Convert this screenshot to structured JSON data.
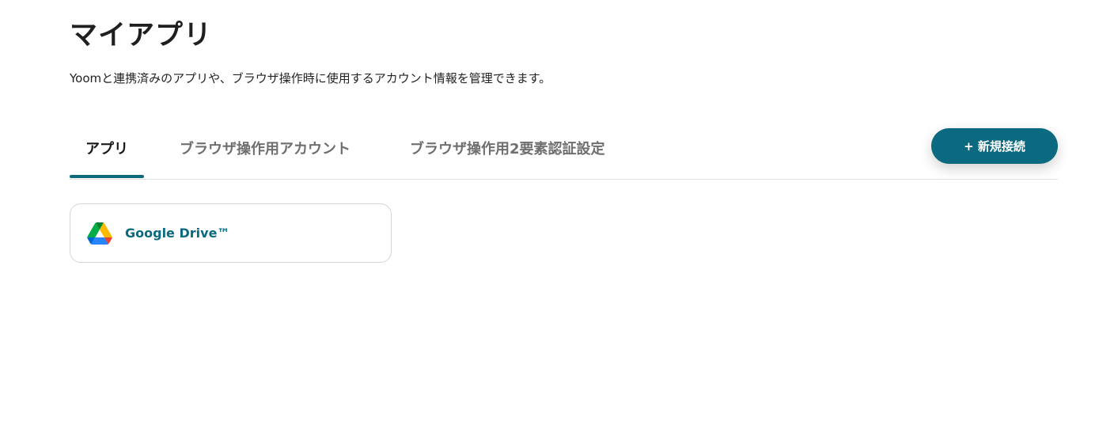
{
  "header": {
    "title": "マイアプリ",
    "description": "Yoomと連携済みのアプリや、ブラウザ操作時に使用するアカウント情報を管理できます。"
  },
  "tabs": [
    {
      "label": "アプリ",
      "active": true
    },
    {
      "label": "ブラウザ操作用アカウント",
      "active": false
    },
    {
      "label": "ブラウザ操作用2要素認証設定",
      "active": false
    }
  ],
  "actions": {
    "add_connection_label": "+ 新規接続"
  },
  "apps": [
    {
      "name": "Google Drive™",
      "icon": "google-drive-icon"
    }
  ],
  "colors": {
    "accent": "#0b6a7f",
    "tab_inactive": "#6f6f6f",
    "text": "#1f1f1f",
    "border": "#d6d6d6"
  }
}
